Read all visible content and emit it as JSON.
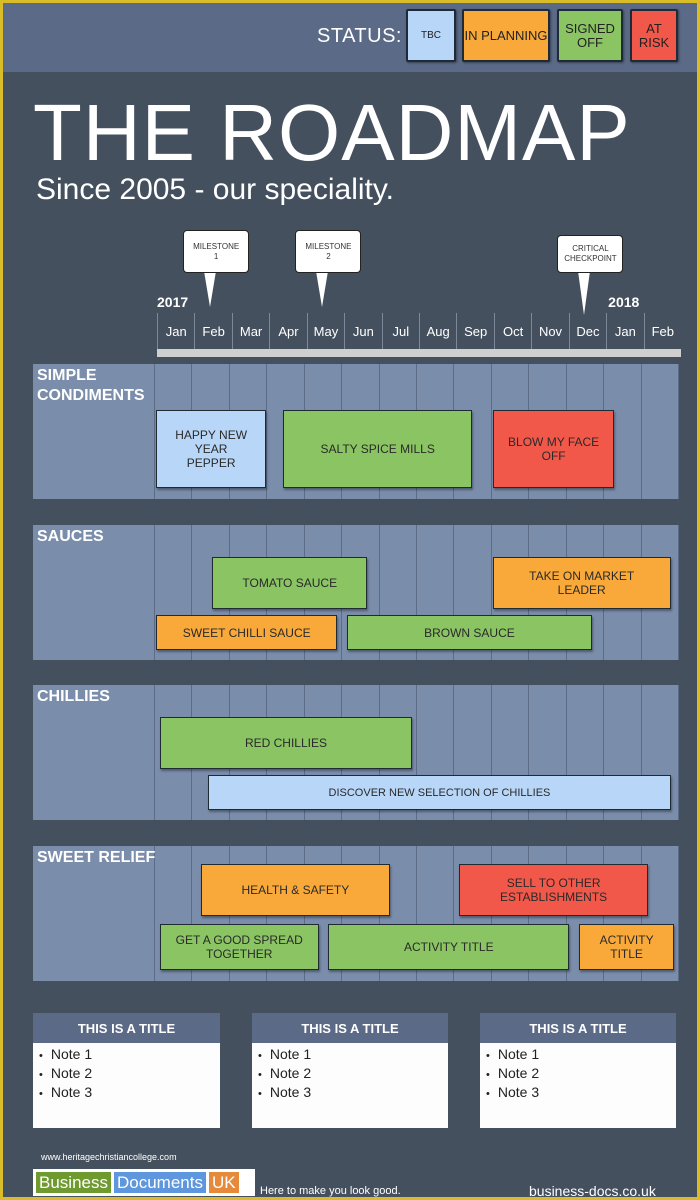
{
  "status_legend": {
    "label": "STATUS:",
    "items": [
      {
        "key": "tbc",
        "label": "TBC",
        "color": "#b8d6f7"
      },
      {
        "key": "planning",
        "label": "IN PLANNING",
        "color": "#f8a93a"
      },
      {
        "key": "signed",
        "label": "SIGNED OFF",
        "color": "#8ac463"
      },
      {
        "key": "risk",
        "label": "AT RISK",
        "color": "#f2584a"
      }
    ]
  },
  "header": {
    "title": "THE ROADMAP",
    "subtitle": "Since 2005 - our speciality."
  },
  "timeline": {
    "years": [
      {
        "label": "2017",
        "month_index": 0
      },
      {
        "label": "2018",
        "month_index": 12
      }
    ],
    "months": [
      "Jan",
      "Feb",
      "Mar",
      "Apr",
      "May",
      "Jun",
      "Jul",
      "Aug",
      "Sep",
      "Oct",
      "Nov",
      "Dec",
      "Jan",
      "Feb"
    ],
    "markers": [
      {
        "label": "MILESTONE 1",
        "month_index": 1
      },
      {
        "label": "MILESTONE 2",
        "month_index": 4
      },
      {
        "label": "CRITICAL CHECKPOINT",
        "month_index": 11
      }
    ]
  },
  "lanes": [
    {
      "label": "SIMPLE CONDIMENTS",
      "tasks": [
        {
          "label": "HAPPY NEW YEAR PEPPER",
          "status": "tbc",
          "start": 0,
          "end": 3,
          "row": "full"
        },
        {
          "label": "SALTY SPICE MILLS",
          "status": "signed",
          "start": 3.4,
          "end": 8.5,
          "row": "full"
        },
        {
          "label": "BLOW MY FACE OFF",
          "status": "risk",
          "start": 9,
          "end": 12.3,
          "row": "full"
        }
      ]
    },
    {
      "label": "SAUCES",
      "tasks": [
        {
          "label": "TOMATO SAUCE",
          "status": "signed",
          "start": 1.5,
          "end": 5.7,
          "row": "top"
        },
        {
          "label": "TAKE ON MARKET LEADER",
          "status": "planning",
          "start": 9,
          "end": 13.8,
          "row": "top"
        },
        {
          "label": "SWEET CHILLI SAUCE",
          "status": "planning",
          "start": 0,
          "end": 4.9,
          "row": "bottom"
        },
        {
          "label": "BROWN SAUCE",
          "status": "signed",
          "start": 5.1,
          "end": 11.7,
          "row": "bottom"
        }
      ]
    },
    {
      "label": "CHILLIES",
      "tasks": [
        {
          "label": "RED CHILLIES",
          "status": "signed",
          "start": 0.1,
          "end": 6.9,
          "row": "top"
        },
        {
          "label": "DISCOVER NEW SELECTION OF CHILLIES",
          "status": "tbc",
          "start": 1.4,
          "end": 13.8,
          "row": "bottom"
        }
      ]
    },
    {
      "label": "SWEET RELIEF",
      "tasks": [
        {
          "label": "HEALTH & SAFETY",
          "status": "planning",
          "start": 1.2,
          "end": 6.3,
          "row": "top"
        },
        {
          "label": "SELL TO OTHER ESTABLISHMENTS",
          "status": "risk",
          "start": 8.1,
          "end": 13.2,
          "row": "top"
        },
        {
          "label": "GET A GOOD SPREAD TOGETHER",
          "status": "signed",
          "start": 0.1,
          "end": 4.4,
          "row": "bottom"
        },
        {
          "label": "ACTIVITY TITLE",
          "status": "signed",
          "start": 4.6,
          "end": 11.1,
          "row": "bottom"
        },
        {
          "label": "ACTIVITY TITLE",
          "status": "planning",
          "start": 11.3,
          "end": 13.9,
          "row": "bottom"
        }
      ]
    }
  ],
  "notes": [
    {
      "title": "THIS IS A TITLE",
      "items": [
        "Note 1",
        "Note 2",
        "Note 3"
      ]
    },
    {
      "title": "THIS IS A TITLE",
      "items": [
        "Note 1",
        "Note 2",
        "Note 3"
      ]
    },
    {
      "title": "THIS IS A TITLE",
      "items": [
        "Note 1",
        "Note 2",
        "Note 3"
      ]
    }
  ],
  "footer": {
    "credit": "www.heritagechristiancollege.com",
    "logo": [
      {
        "text": "Business",
        "color": "#6f9a2f"
      },
      {
        "text": "Documents",
        "color": "#5e97dd"
      },
      {
        "text": "UK",
        "color": "#e58a3a"
      }
    ],
    "tagline": "Here to make you look good.",
    "site": "business-docs.co.uk"
  }
}
